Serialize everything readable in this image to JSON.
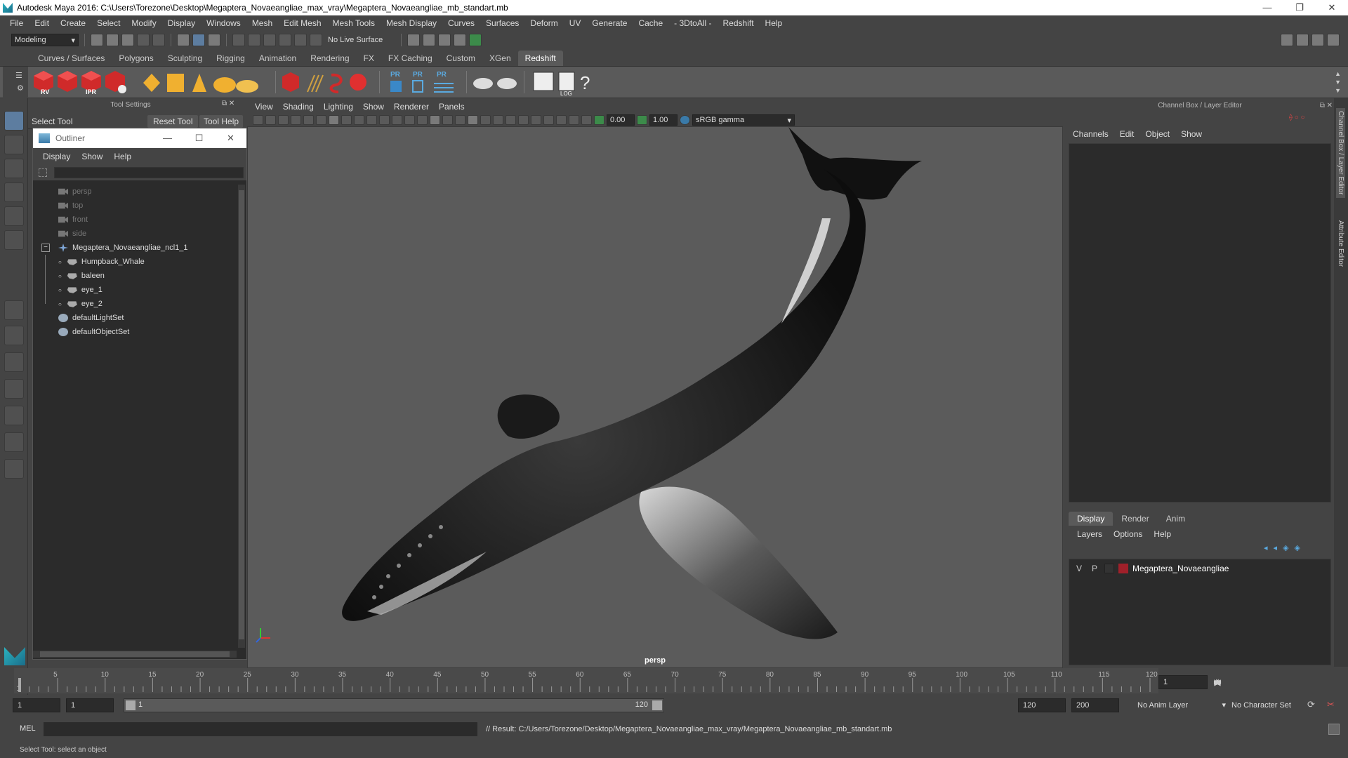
{
  "window": {
    "title": "Autodesk Maya 2016: C:\\Users\\Torezone\\Desktop\\Megaptera_Novaeangliae_max_vray\\Megaptera_Novaeangliae_mb_standart.mb"
  },
  "menubar": [
    "File",
    "Edit",
    "Create",
    "Select",
    "Modify",
    "Display",
    "Windows",
    "Mesh",
    "Edit Mesh",
    "Mesh Tools",
    "Mesh Display",
    "Curves",
    "Surfaces",
    "Deform",
    "UV",
    "Generate",
    "Cache",
    "- 3DtoAll -",
    "Redshift",
    "Help"
  ],
  "statusline": {
    "mode": "Modeling",
    "live_surface": "No Live Surface"
  },
  "shelf": {
    "tabs": [
      "Curves / Surfaces",
      "Polygons",
      "Sculpting",
      "Rigging",
      "Animation",
      "Rendering",
      "FX",
      "FX Caching",
      "Custom",
      "XGen",
      "Redshift"
    ],
    "active_tab": "Redshift",
    "labels": {
      "rv": "RV",
      "ipr": "IPR",
      "pr": "PR",
      "log": "LOG",
      "help": "?"
    }
  },
  "tool_settings": {
    "header": "Tool Settings",
    "tool_name": "Select Tool",
    "reset_label": "Reset Tool",
    "help_label": "Tool Help"
  },
  "outliner": {
    "title": "Outliner",
    "menu": [
      "Display",
      "Show",
      "Help"
    ],
    "items": [
      {
        "label": "persp",
        "type": "camera",
        "dim": true
      },
      {
        "label": "top",
        "type": "camera",
        "dim": true
      },
      {
        "label": "front",
        "type": "camera",
        "dim": true
      },
      {
        "label": "side",
        "type": "camera",
        "dim": true
      },
      {
        "label": "Megaptera_Novaeangliae_ncl1_1",
        "type": "group",
        "dim": false
      },
      {
        "label": "Humpback_Whale",
        "type": "mesh",
        "dim": false
      },
      {
        "label": "baleen",
        "type": "mesh",
        "dim": false
      },
      {
        "label": "eye_1",
        "type": "mesh",
        "dim": false
      },
      {
        "label": "eye_2",
        "type": "mesh",
        "dim": false
      },
      {
        "label": "defaultLightSet",
        "type": "set",
        "dim": false
      },
      {
        "label": "defaultObjectSet",
        "type": "set",
        "dim": false
      }
    ]
  },
  "viewport": {
    "menu": [
      "View",
      "Shading",
      "Lighting",
      "Show",
      "Renderer",
      "Panels"
    ],
    "exposure": "0.00",
    "gamma": "1.00",
    "color_space": "sRGB gamma",
    "camera_label": "persp"
  },
  "channel_box": {
    "header": "Channel Box / Layer Editor",
    "menu": [
      "Channels",
      "Edit",
      "Object",
      "Show"
    ]
  },
  "layer_editor": {
    "tabs": [
      "Display",
      "Render",
      "Anim"
    ],
    "active_tab": "Display",
    "menu": [
      "Layers",
      "Options",
      "Help"
    ],
    "layers": [
      {
        "v": "V",
        "p": "P",
        "name": "Megaptera_Novaeangliae",
        "color": "#a0202a"
      }
    ]
  },
  "side_tabs": [
    "Channel Box / Layer Editor",
    "Attribute Editor"
  ],
  "timeslider": {
    "ticks": [
      "5",
      "10",
      "15",
      "20",
      "25",
      "30",
      "35",
      "40",
      "45",
      "50",
      "55",
      "60",
      "65",
      "70",
      "75",
      "80",
      "85",
      "90",
      "95",
      "100",
      "105",
      "110",
      "115",
      "120"
    ],
    "start_mark": "1",
    "current_frame": "1"
  },
  "range": {
    "start": "1",
    "anim_start": "1",
    "slider_start": "1",
    "slider_end": "120",
    "end": "120",
    "anim_end": "200",
    "anim_layer": "No Anim Layer",
    "character_set": "No Character Set"
  },
  "cmdline": {
    "lang": "MEL",
    "result": "// Result: C:/Users/Torezone/Desktop/Megaptera_Novaeangliae_max_vray/Megaptera_Novaeangliae_mb_standart.mb"
  },
  "helpline": {
    "text": "Select Tool: select an object"
  },
  "colors": {
    "bg": "#444444",
    "panel": "#2b2b2b",
    "viewport": "#5b5b5b",
    "accent": "#5d7da0",
    "layer_red": "#a0202a"
  }
}
